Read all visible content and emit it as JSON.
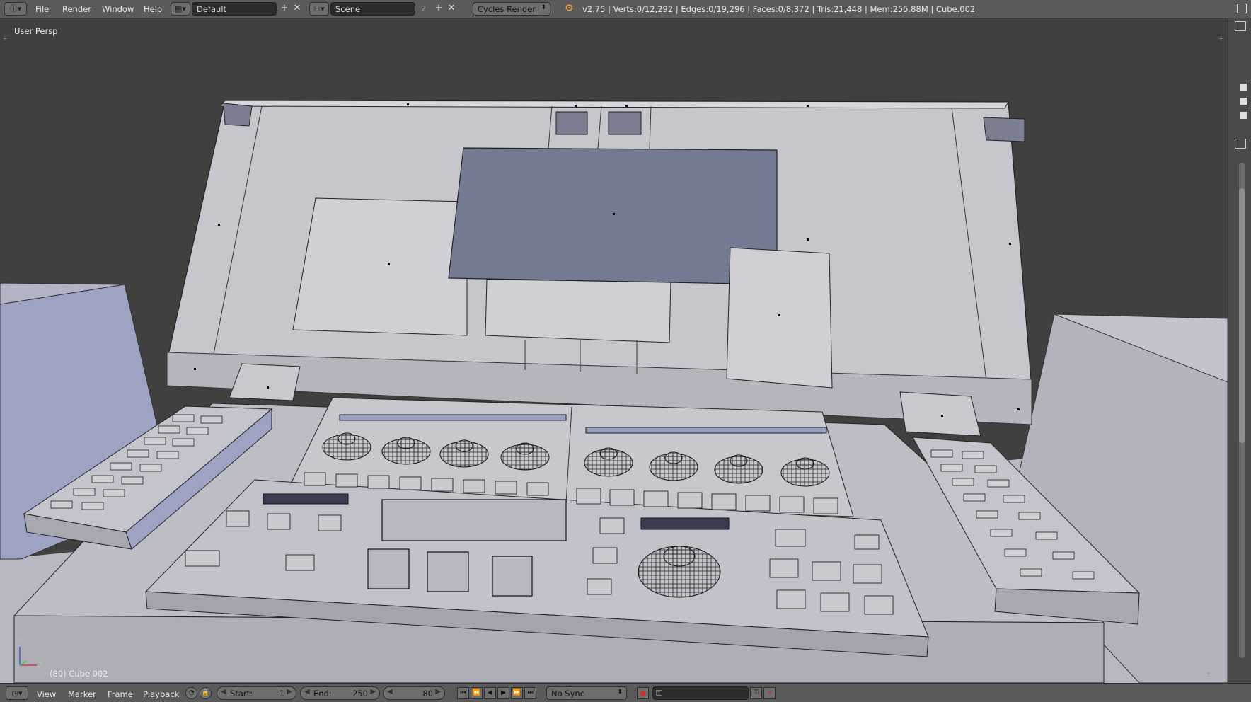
{
  "header": {
    "menus": [
      "File",
      "Render",
      "Window",
      "Help"
    ],
    "layout_name": "Default",
    "scene_name": "Scene",
    "scene_users": "2",
    "render_engine": "Cycles Render",
    "stats": "v2.75 | Verts:0/12,292 | Edges:0/19,296 | Faces:0/8,372 | Tris:21,448 | Mem:255.88M | Cube.002"
  },
  "viewport": {
    "view_label": "User Persp",
    "object_label": "(80) Cube.002",
    "axis_labels": {
      "x": "x",
      "z": "z"
    }
  },
  "timeline": {
    "menus": [
      "View",
      "Marker",
      "Frame",
      "Playback"
    ],
    "start_label": "Start:",
    "start_value": "1",
    "end_label": "End:",
    "end_value": "250",
    "current_frame": "80",
    "sync_mode": "No Sync"
  },
  "colors": {
    "header_bg": "#5a5a5a",
    "viewport_bg": "#404040",
    "panel_face": "#c2c3ca",
    "screen_face": "#737a91"
  }
}
